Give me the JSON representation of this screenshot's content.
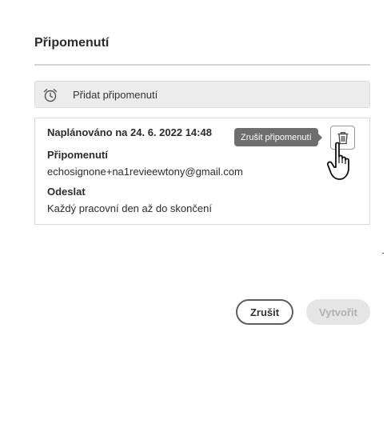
{
  "dialog": {
    "title": "Připomenutí"
  },
  "add_reminder": {
    "icon": "alarm-clock-icon",
    "label": "Přidat připomenutí"
  },
  "reminder_card": {
    "scheduled": "Naplánováno na 24. 6. 2022 14:48",
    "recipient_heading": "Připomenutí",
    "recipient_value": "echosignone+na1revieewtony@gmail.com",
    "send_heading": "Odeslat",
    "send_value": "Každý pracovní den až do skončení",
    "delete_icon": "trash-icon",
    "delete_tooltip": "Zrušit připomenutí"
  },
  "footer": {
    "cancel_label": "Zrušit",
    "create_label": "Vytvořit"
  },
  "colors": {
    "tooltip_bg": "#6e6e6e",
    "disabled_bg": "#e5e5e5",
    "disabled_text": "#b0b0b0"
  }
}
